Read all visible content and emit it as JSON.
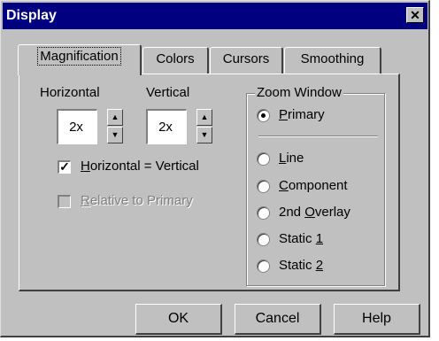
{
  "window": {
    "title": "Display",
    "close_glyph": "✕"
  },
  "tabs": [
    {
      "label": "Magnification",
      "active": true
    },
    {
      "label": "Colors",
      "active": false
    },
    {
      "label": "Cursors",
      "active": false
    },
    {
      "label": "Smoothing",
      "active": false
    }
  ],
  "magnification": {
    "horizontal_label": "Horizontal",
    "vertical_label": "Vertical",
    "horizontal_value": "2x",
    "vertical_value": "2x",
    "spin_up_glyph": "▲",
    "spin_down_glyph": "▼",
    "horiz_eq_vert": {
      "pre": "",
      "mnemonic": "H",
      "post": "orizontal = Vertical",
      "checked": true
    },
    "relative_to_primary": {
      "pre": "",
      "mnemonic": "R",
      "post": "elative to Primary",
      "checked": false,
      "disabled": true
    }
  },
  "zoom_window": {
    "title": "Zoom Window",
    "options": [
      {
        "pre": "",
        "mnemonic": "P",
        "post": "rimary",
        "selected": true
      },
      {
        "pre": "",
        "mnemonic": "L",
        "post": "ine",
        "selected": false
      },
      {
        "pre": "",
        "mnemonic": "C",
        "post": "omponent",
        "selected": false
      },
      {
        "pre": "2nd ",
        "mnemonic": "O",
        "post": "verlay",
        "selected": false
      },
      {
        "pre": "Static ",
        "mnemonic": "1",
        "post": "",
        "selected": false
      },
      {
        "pre": "Static ",
        "mnemonic": "2",
        "post": "",
        "selected": false
      }
    ]
  },
  "buttons": {
    "ok": "OK",
    "cancel": "Cancel",
    "help": "Help"
  },
  "colors": {
    "titlebar": "#000080",
    "face": "#c0c0c0"
  }
}
